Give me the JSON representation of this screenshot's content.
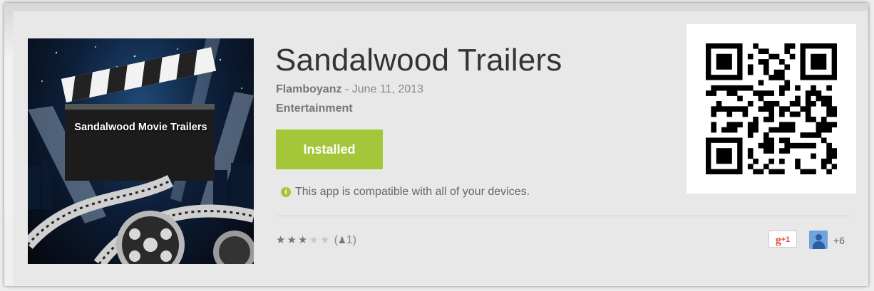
{
  "app": {
    "title": "Sandalwood Trailers",
    "developer": "Flamboyanz",
    "separator": " - ",
    "date": "June 11, 2013",
    "category": "Entertainment",
    "icon_caption": "Sandalwood Movie Trailers"
  },
  "install_button": {
    "label": "Installed",
    "color": "#a4c639"
  },
  "compatibility": {
    "icon": "info-icon",
    "text": "This app is compatible with all of your devices."
  },
  "rating": {
    "stars_filled": 3,
    "stars_total": 5,
    "open": "(",
    "count": "1",
    "close": ")"
  },
  "social": {
    "gplus_label": "+1",
    "gplus_g": "g",
    "plus_count": "+6"
  },
  "qr_code": {
    "icon": "qr-code"
  }
}
